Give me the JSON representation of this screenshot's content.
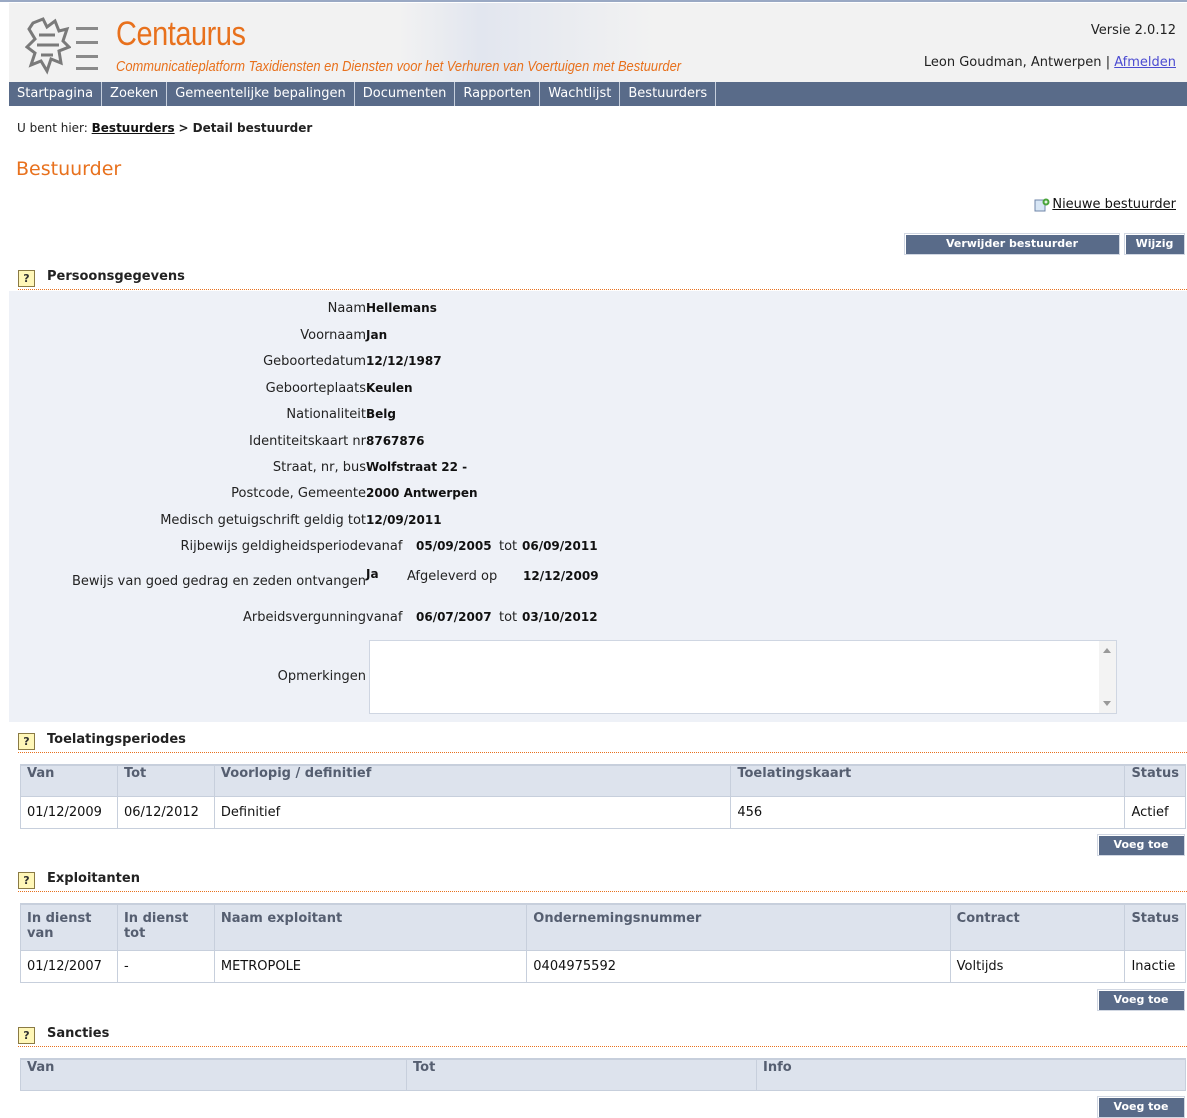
{
  "app": {
    "brand": "Centaurus",
    "subtitle": "Communicatieplatform Taxidiensten en Diensten voor  het Verhuren van Voertuigen met Bestuurder",
    "version": "Versie 2.0.12",
    "user": "Leon Goudman, Antwerpen",
    "separator": "|",
    "logout": "Afmelden"
  },
  "nav": [
    "Startpagina",
    "Zoeken",
    "Gemeentelijke bepalingen",
    "Documenten",
    "Rapporten",
    "Wachtlijst",
    "Bestuurders"
  ],
  "breadcrumb": {
    "prefix": "U bent hier:",
    "link": "Bestuurders",
    "current": "> Detail bestuurder"
  },
  "page_title": "Bestuurder",
  "actions": {
    "new_driver": "Nieuwe bestuurder",
    "delete": "Verwijder bestuurder",
    "edit": "Wijzig"
  },
  "sections": {
    "personal": "Persoonsgegevens",
    "admissions": "Toelatingsperiodes",
    "operators": "Exploitanten",
    "sanctions": "Sancties"
  },
  "help_glyph": "?",
  "personal": {
    "naam": {
      "label": "Naam",
      "value": "Hellemans"
    },
    "voornaam": {
      "label": "Voornaam",
      "value": "Jan"
    },
    "geboortedatum": {
      "label": "Geboortedatum",
      "value": "12/12/1987"
    },
    "geboorteplaats": {
      "label": "Geboorteplaats",
      "value": "Keulen"
    },
    "nationaliteit": {
      "label": "Nationaliteit",
      "value": "Belg"
    },
    "idkaart": {
      "label": "Identiteitskaart nr",
      "value": "8767876"
    },
    "straat": {
      "label": "Straat, nr, bus",
      "value": "Wolfstraat 22 -"
    },
    "postcode": {
      "label": "Postcode, Gemeente",
      "value": "2000 Antwerpen"
    },
    "medisch": {
      "label": "Medisch getuigschrift geldig tot",
      "value": "12/09/2011"
    },
    "rijbewijs": {
      "label": "Rijbewijs geldigheidsperiode",
      "vanaf_label": "vanaf",
      "vanaf": "05/09/2005",
      "tot_label": "tot",
      "tot": "06/09/2011"
    },
    "gedrag": {
      "label": "Bewijs van goed gedrag en zeden ontvangen",
      "value": "Ja",
      "afgeleverd_label": "Afgeleverd op",
      "afgeleverd": "12/12/2009"
    },
    "arbeid": {
      "label": "Arbeidsvergunning",
      "vanaf_label": "vanaf",
      "vanaf": "06/07/2007",
      "tot_label": "tot",
      "tot": "03/10/2012"
    },
    "opmerkingen": {
      "label": "Opmerkingen",
      "value": ""
    }
  },
  "admissions": {
    "headers": [
      "Van",
      "Tot",
      "Voorlopig / definitief",
      "Toelatingskaart",
      "Status"
    ],
    "rows": [
      [
        "01/12/2009",
        "06/12/2012",
        "Definitief",
        "456",
        "Actief"
      ]
    ],
    "add": "Voeg toe"
  },
  "operators": {
    "headers": [
      "In dienst van",
      "In dienst tot",
      "Naam exploitant",
      "Ondernemingsnummer",
      "Contract",
      "Status"
    ],
    "rows": [
      [
        "01/12/2007",
        "-",
        "METROPOLE",
        "0404975592",
        "Voltijds",
        "Inactie"
      ]
    ],
    "add": "Voeg toe"
  },
  "sanctions": {
    "headers": [
      "Van",
      "Tot",
      "Info"
    ],
    "add": "Voeg toe"
  }
}
